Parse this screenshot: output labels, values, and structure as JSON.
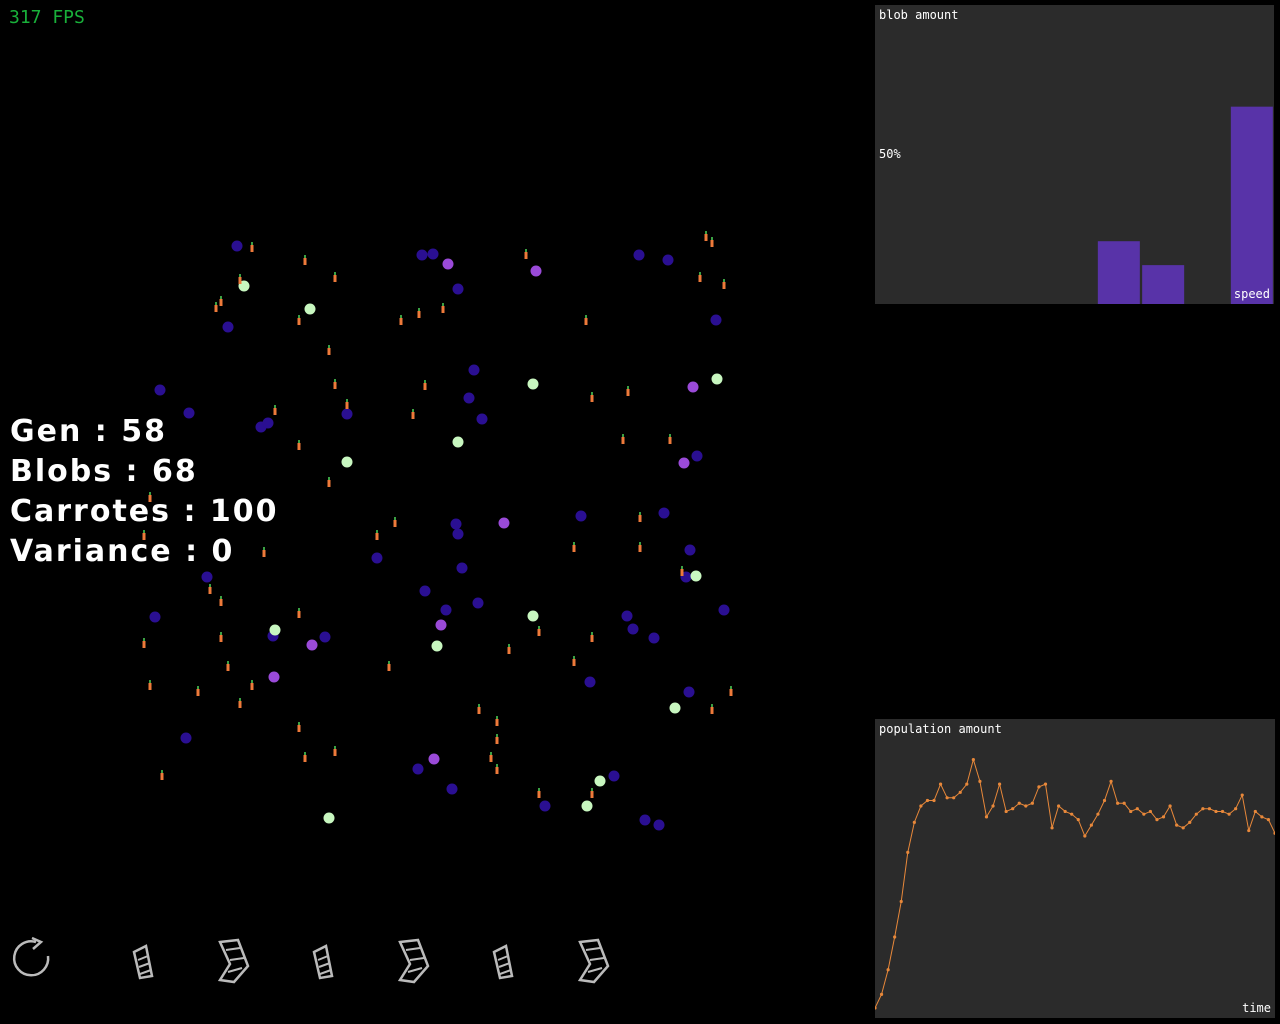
{
  "fps": "317 FPS",
  "stats": {
    "gen": "Gen : 58",
    "blobs": "Blobs : 68",
    "carrots": "Carrotes : 100",
    "variance": "Variance : 0"
  },
  "blob_chart": {
    "title": "blob amount",
    "mid_label": "50%",
    "x_label": "speed",
    "bar_color": "#5833a8",
    "chart_data": {
      "type": "bar",
      "title": "blob amount",
      "xlabel": "speed",
      "ylabel": "",
      "ylim": [
        0,
        100
      ],
      "values": [
        0,
        0,
        0,
        0,
        0,
        21,
        13,
        0,
        66
      ]
    }
  },
  "population_chart": {
    "title": "population amount",
    "x_label": "time",
    "line_color": "#e8883a",
    "chart_data": {
      "type": "line",
      "title": "population amount",
      "xlabel": "time",
      "ylabel": "",
      "values": [
        0,
        5,
        14,
        26,
        39,
        57,
        68,
        74,
        76,
        76,
        82,
        77,
        77,
        79,
        82,
        91,
        83,
        70,
        74,
        82,
        72,
        73,
        75,
        74,
        75,
        81,
        82,
        66,
        74,
        72,
        71,
        69,
        63,
        67,
        71,
        76,
        83,
        75,
        75,
        72,
        73,
        71,
        72,
        69,
        70,
        74,
        67,
        66,
        68,
        71,
        73,
        73,
        72,
        72,
        71,
        73,
        78,
        65,
        72,
        70,
        69,
        64
      ]
    }
  },
  "controls": [
    {
      "name": "restart-button",
      "icon": "restart-icon"
    },
    {
      "name": "speed-slow-1-button",
      "icon": "slow-icon"
    },
    {
      "name": "speed-fast-1-button",
      "icon": "fast-icon"
    },
    {
      "name": "speed-slow-2-button",
      "icon": "slow-icon"
    },
    {
      "name": "speed-fast-2-button",
      "icon": "fast-icon"
    },
    {
      "name": "speed-slow-3-button",
      "icon": "slow-icon"
    },
    {
      "name": "speed-fast-3-button",
      "icon": "fast-icon"
    }
  ],
  "colors": {
    "blob_dark": "#2a0f92",
    "blob_purple": "#9a4ad8",
    "blob_green": "#c8f7c0",
    "carrot": "#ee7a3a",
    "carrot_leaf": "#3aa043"
  }
}
